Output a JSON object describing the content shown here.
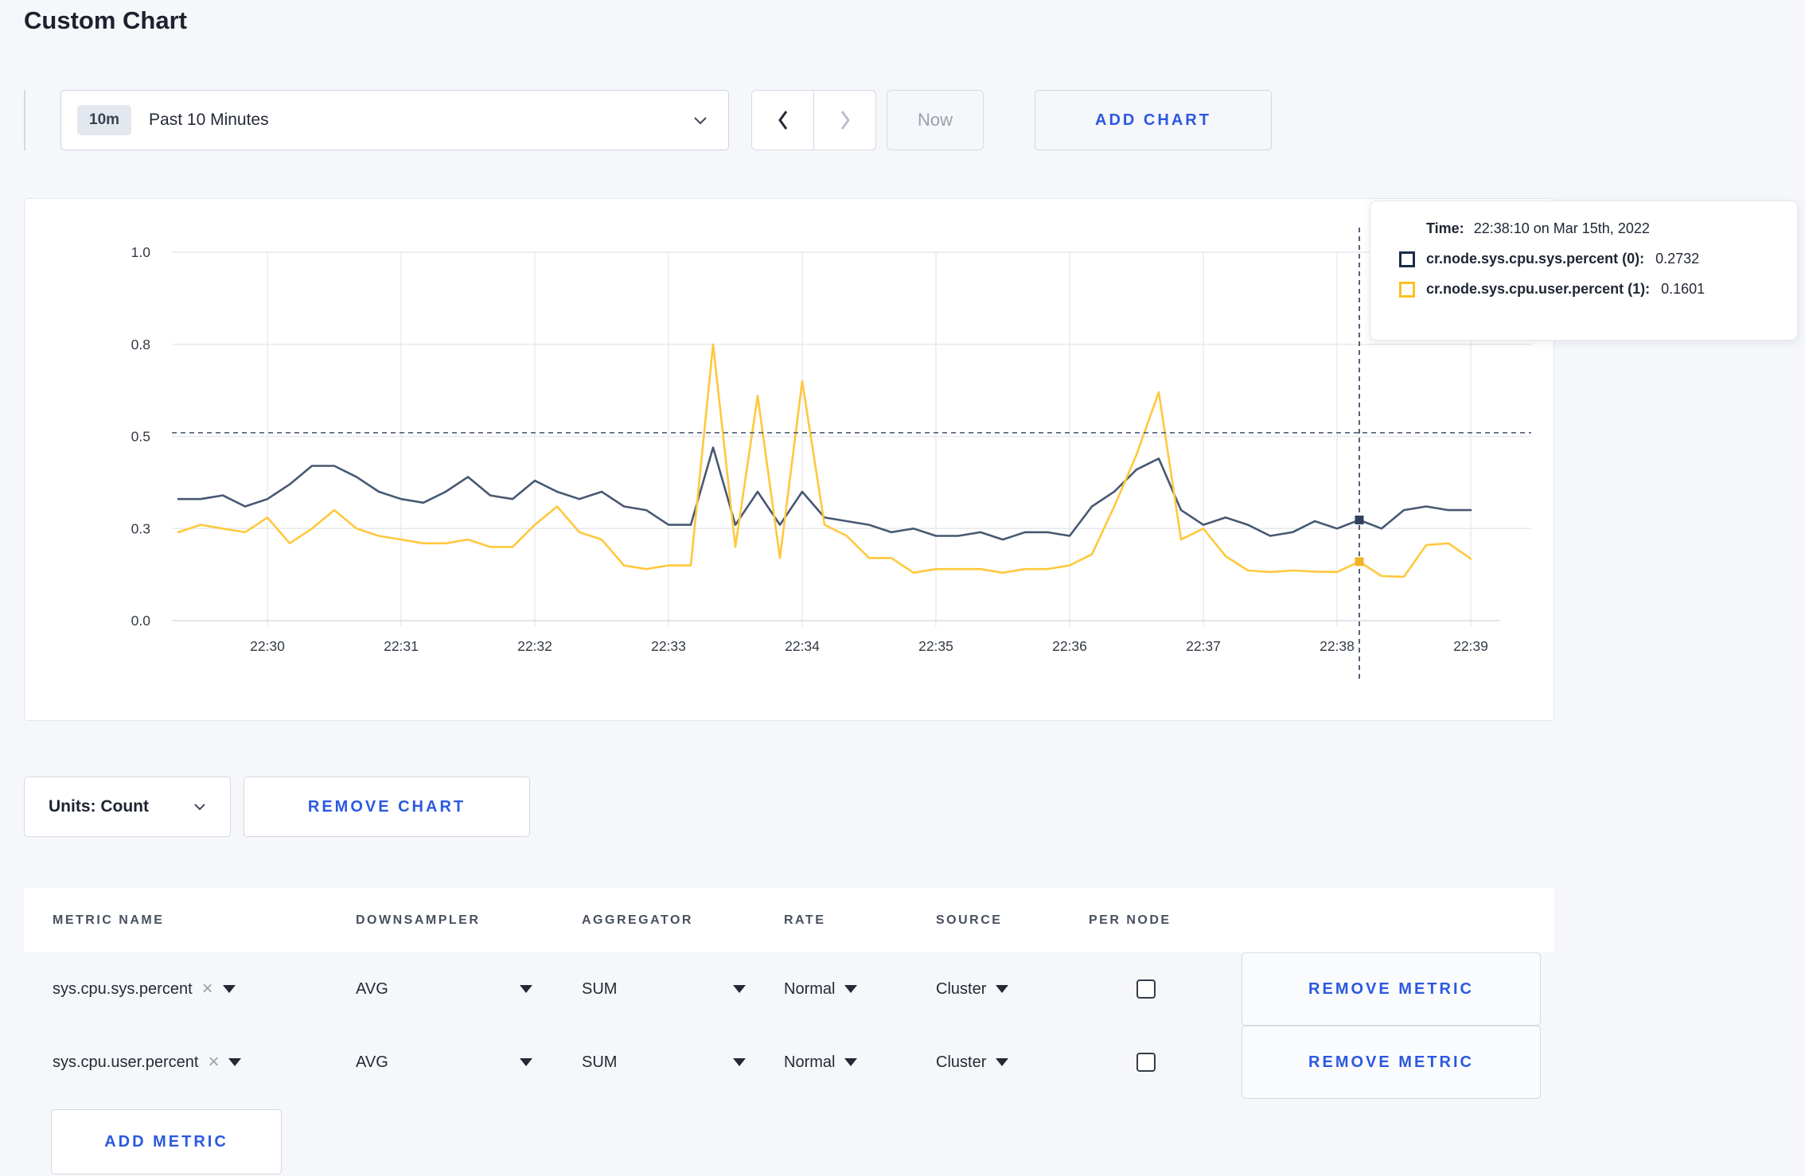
{
  "page": {
    "title": "Custom Chart"
  },
  "toolbar": {
    "time_window_badge": "10m",
    "time_window_label": "Past 10 Minutes",
    "now_label": "Now",
    "add_chart_label": "ADD CHART"
  },
  "chart_controls": {
    "units_label": "Units: Count",
    "remove_chart_label": "REMOVE CHART"
  },
  "tooltip": {
    "time_label": "Time:",
    "time_value": "22:38:10 on Mar 15th, 2022",
    "rows": [
      {
        "label": "cr.node.sys.cpu.sys.percent (0):",
        "value": "0.2732",
        "color": "#1c2b4a"
      },
      {
        "label": "cr.node.sys.cpu.user.percent (1):",
        "value": "0.1601",
        "color": "#ffc020"
      }
    ]
  },
  "icons": {
    "clear": "×"
  },
  "metrics": {
    "columns": [
      "METRIC NAME",
      "DOWNSAMPLER",
      "AGGREGATOR",
      "RATE",
      "SOURCE",
      "PER NODE"
    ],
    "rows": [
      {
        "metric": "sys.cpu.sys.percent",
        "downsampler": "AVG",
        "aggregator": "SUM",
        "rate": "Normal",
        "source": "Cluster",
        "per_node_checked": false,
        "remove_label": "REMOVE METRIC"
      },
      {
        "metric": "sys.cpu.user.percent",
        "downsampler": "AVG",
        "aggregator": "SUM",
        "rate": "Normal",
        "source": "Cluster",
        "per_node_checked": false,
        "remove_label": "REMOVE METRIC"
      }
    ],
    "add_metric_label": "ADD METRIC"
  },
  "chart_data": {
    "type": "line",
    "title": "",
    "xlabel": "",
    "ylabel": "",
    "ylim": [
      0,
      1
    ],
    "grid": true,
    "legend_position": "tooltip",
    "x_start": "22:29:20",
    "x_interval_seconds": 10,
    "x_tick_labels": [
      "22:30",
      "22:31",
      "22:32",
      "22:33",
      "22:34",
      "22:35",
      "22:36",
      "22:37",
      "22:38",
      "22:39"
    ],
    "y_ticks": [
      {
        "value": 0,
        "label": "0.0"
      },
      {
        "value": 0.25,
        "label": "0.3"
      },
      {
        "value": 0.5,
        "label": "0.5"
      },
      {
        "value": 0.75,
        "label": "0.8"
      },
      {
        "value": 1,
        "label": "1.0"
      }
    ],
    "series": [
      {
        "name": "cr.node.sys.cpu.sys.percent (0)",
        "color": "#475872",
        "values": [
          0.33,
          0.33,
          0.34,
          0.31,
          0.33,
          0.37,
          0.42,
          0.42,
          0.39,
          0.35,
          0.33,
          0.32,
          0.35,
          0.39,
          0.34,
          0.33,
          0.38,
          0.35,
          0.33,
          0.35,
          0.31,
          0.3,
          0.26,
          0.26,
          0.47,
          0.26,
          0.35,
          0.26,
          0.35,
          0.28,
          0.27,
          0.26,
          0.24,
          0.25,
          0.23,
          0.23,
          0.24,
          0.22,
          0.24,
          0.24,
          0.23,
          0.31,
          0.35,
          0.41,
          0.44,
          0.3,
          0.26,
          0.28,
          0.26,
          0.23,
          0.24,
          0.27,
          0.25,
          0.2732,
          0.25,
          0.3,
          0.31,
          0.3,
          0.3
        ]
      },
      {
        "name": "cr.node.sys.cpu.user.percent (1)",
        "color": "#ffc83d",
        "values": [
          0.24,
          0.26,
          0.25,
          0.24,
          0.28,
          0.21,
          0.25,
          0.3,
          0.25,
          0.23,
          0.22,
          0.21,
          0.21,
          0.22,
          0.2,
          0.2,
          0.26,
          0.31,
          0.24,
          0.22,
          0.15,
          0.14,
          0.15,
          0.15,
          0.75,
          0.2,
          0.61,
          0.17,
          0.65,
          0.26,
          0.23,
          0.17,
          0.17,
          0.13,
          0.14,
          0.14,
          0.14,
          0.13,
          0.14,
          0.14,
          0.15,
          0.18,
          0.31,
          0.45,
          0.62,
          0.22,
          0.25,
          0.175,
          0.136,
          0.132,
          0.136,
          0.133,
          0.132,
          0.1601,
          0.121,
          0.119,
          0.205,
          0.21,
          0.168
        ]
      }
    ],
    "crosshair": {
      "time": "22:38:10",
      "horizontal_value": 0.51,
      "points": [
        {
          "series": 0,
          "value": 0.2732,
          "dot_color": "#32405d"
        },
        {
          "series": 1,
          "value": 0.1601,
          "dot_color": "#f2b32b"
        }
      ]
    }
  }
}
